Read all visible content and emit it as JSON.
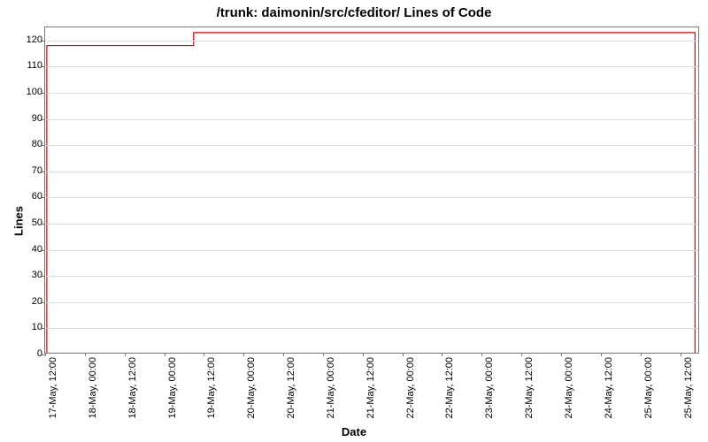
{
  "chart_data": {
    "type": "line",
    "title": "/trunk: daimonin/src/cfeditor/ Lines of Code",
    "xlabel": "Date",
    "ylabel": "Lines",
    "ylim": [
      0,
      125
    ],
    "yticks": [
      0,
      10,
      20,
      30,
      40,
      50,
      60,
      70,
      80,
      90,
      100,
      110,
      120
    ],
    "x_categories": [
      "17-May, 12:00",
      "18-May, 00:00",
      "18-May, 12:00",
      "19-May, 00:00",
      "19-May, 12:00",
      "20-May, 00:00",
      "20-May, 12:00",
      "21-May, 00:00",
      "21-May, 12:00",
      "22-May, 00:00",
      "22-May, 12:00",
      "23-May, 00:00",
      "23-May, 12:00",
      "24-May, 00:00",
      "24-May, 12:00",
      "25-May, 00:00",
      "25-May, 12:00"
    ],
    "series": [
      {
        "name": "Lines of Code",
        "color": "#e00000",
        "points": [
          {
            "x": "17-May, 12:30",
            "y": 0
          },
          {
            "x": "17-May, 12:30",
            "y": 118
          },
          {
            "x": "19-May, 09:00",
            "y": 118
          },
          {
            "x": "19-May, 09:00",
            "y": 123
          },
          {
            "x": "25-May, 17:00",
            "y": 123
          },
          {
            "x": "25-May, 17:00",
            "y": 0
          }
        ]
      }
    ],
    "x_domain_hours": {
      "start": 12,
      "end": 210
    },
    "x_point_hours": [
      12.5,
      12.5,
      57,
      57,
      209,
      209
    ]
  }
}
